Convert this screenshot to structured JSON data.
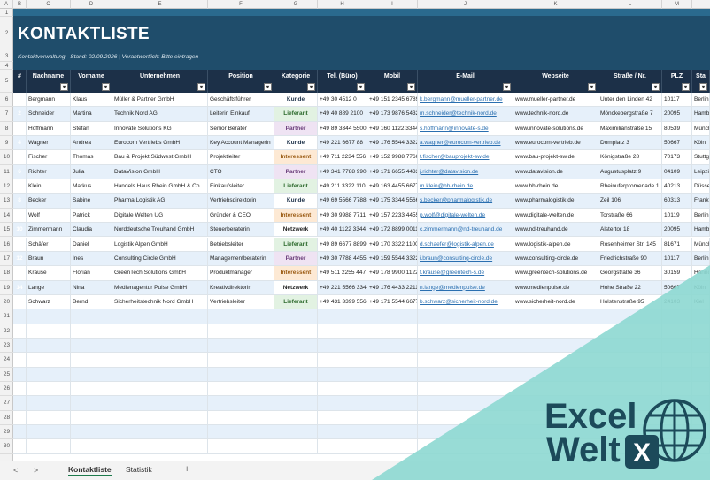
{
  "columns": [
    "A",
    "B",
    "C",
    "D",
    "E",
    "F",
    "G",
    "H",
    "I",
    "J",
    "K",
    "L",
    "M"
  ],
  "banner": {
    "title": "KONTAKTLISTE",
    "subtitle": "Kontaktverwaltung · Stand: 02.09.2026 | Verantwortlich: Bitte eintragen"
  },
  "headers": [
    "#",
    "Nachname",
    "Vorname",
    "Unternehmen",
    "Position",
    "Kategorie",
    "Tel. (Büro)",
    "Mobil",
    "E-Mail",
    "Webseite",
    "Straße / Nr.",
    "PLZ",
    "Sta"
  ],
  "filter_icon": "dropdown-arrow-icon",
  "rows": [
    [
      "1",
      "Bergmann",
      "Klaus",
      "Müller & Partner GmbH",
      "Geschäftsführer",
      "Kunde",
      "+49 30 4512 0",
      "+49 151 2345 6789",
      "k.bergmann@mueller-partner.de",
      "www.mueller-partner.de",
      "Unter den Linden 42",
      "10117",
      "Berlin"
    ],
    [
      "2",
      "Schneider",
      "Martina",
      "Technik Nord AG",
      "Leiterin Einkauf",
      "Lieferant",
      "+49 40 889 2100",
      "+49 173 9876 5432",
      "m.schneider@technik-nord.de",
      "www.technik-nord.de",
      "Mönckebergstraße 7",
      "20095",
      "Hamb"
    ],
    [
      "3",
      "Hoffmann",
      "Stefan",
      "Innovate Solutions KG",
      "Senior Berater",
      "Partner",
      "+49 89 3344 5500",
      "+49 160 1122 3344",
      "s.hoffmann@innovate-s.de",
      "www.innovate-solutions.de",
      "Maximilianstraße 15",
      "80539",
      "Münch"
    ],
    [
      "4",
      "Wagner",
      "Andrea",
      "Eurocom Vertriebs GmbH",
      "Key Account Managerin",
      "Kunde",
      "+49 221 6677 88",
      "+49 176 5544 3322",
      "a.wagner@eurocom-vertrieb.de",
      "www.eurocom-vertrieb.de",
      "Domplatz 3",
      "50667",
      "Köln"
    ],
    [
      "5",
      "Fischer",
      "Thomas",
      "Bau & Projekt Südwest GmbH",
      "Projektleiter",
      "Interessent",
      "+49 711 2234 556",
      "+49 152 9988 7766",
      "t.fischer@bauprojekt-sw.de",
      "www.bau-projekt-sw.de",
      "Königstraße 28",
      "70173",
      "Stuttg"
    ],
    [
      "6",
      "Richter",
      "Julia",
      "DataVision GmbH",
      "CTO",
      "Partner",
      "+49 341 7788 990",
      "+49 171 6655 4433",
      "j.richter@datavision.de",
      "www.datavision.de",
      "Augustusplatz 9",
      "04109",
      "Leipzi"
    ],
    [
      "7",
      "Klein",
      "Markus",
      "Handels Haus Rhein GmbH & Co.",
      "Einkaufsleiter",
      "Lieferant",
      "+49 211 3322 110",
      "+49 163 4455 6677",
      "m.klein@hh-rhein.de",
      "www.hh-rhein.de",
      "Rheinuferpromenade 1",
      "40213",
      "Düsse"
    ],
    [
      "8",
      "Becker",
      "Sabine",
      "Pharma Logistik AG",
      "Vertriebsdirektorin",
      "Kunde",
      "+49 69 5566 7788",
      "+49 175 3344 5566",
      "s.becker@pharmalogistik.de",
      "www.pharmalogistik.de",
      "Zeil 106",
      "60313",
      "Frankf"
    ],
    [
      "9",
      "Wolf",
      "Patrick",
      "Digitale Welten UG",
      "Gründer & CEO",
      "Interessent",
      "+49 30 9988 7711",
      "+49 157 2233 4455",
      "p.wolf@digitale-welten.de",
      "www.digitale-welten.de",
      "Torstraße 66",
      "10119",
      "Berlin"
    ],
    [
      "10",
      "Zimmermann",
      "Claudia",
      "Norddeutsche Treuhand GmbH",
      "Steuerberaterin",
      "Netzwerk",
      "+49 40 1122 3344",
      "+49 172 8899 0011",
      "c.zimmermann@nd-treuhand.de",
      "www.nd-treuhand.de",
      "Alstertor 18",
      "20095",
      "Hamb"
    ],
    [
      "11",
      "Schäfer",
      "Daniel",
      "Logistik Alpen GmbH",
      "Betriebsleiter",
      "Lieferant",
      "+49 89 6677 8899",
      "+49 170 3322 1100",
      "d.schaefer@logistik-alpen.de",
      "www.logistik-alpen.de",
      "Rosenheimer Str. 145",
      "81671",
      "Münch"
    ],
    [
      "12",
      "Braun",
      "Ines",
      "Consulting Circle GmbH",
      "Managementberaterin",
      "Partner",
      "+49 30 7788 4455",
      "+49 159 5544 3322",
      "i.braun@consulting-circle.de",
      "www.consulting-circle.de",
      "Friedrichstraße 90",
      "10117",
      "Berlin"
    ],
    [
      "13",
      "Krause",
      "Florian",
      "GreenTech Solutions GmbH",
      "Produktmanager",
      "Interessent",
      "+49 511 2255 4477",
      "+49 178 9900 1122",
      "f.krause@greentech-s.de",
      "www.greentech-solutions.de",
      "Georgstraße 36",
      "30159",
      "Hanno"
    ],
    [
      "14",
      "Lange",
      "Nina",
      "Medienagentur Pulse GmbH",
      "Kreativdirektorin",
      "Netzwerk",
      "+49 221 5566 3344",
      "+49 176 4433 2211",
      "n.lange@medienpulse.de",
      "www.medienpulse.de",
      "Hohe Straße 22",
      "50667",
      "Köln"
    ],
    [
      "15",
      "Schwarz",
      "Bernd",
      "Sicherheitstechnik Nord GmbH",
      "Vertriebsleiter",
      "Lieferant",
      "+49 431 3399 5566",
      "+49 171 5544 6677",
      "b.schwarz@sicherheit-nord.de",
      "www.sicherheit-nord.de",
      "Holstenstraße 95",
      "24103",
      "Kiel"
    ]
  ],
  "category_colors": {
    "Kunde": {
      "bg": "#ffffff",
      "fg": "#1c3048"
    },
    "Lieferant": {
      "bg": "#e2f2e2",
      "fg": "#2d6a2d"
    },
    "Partner": {
      "bg": "#efe3f3",
      "fg": "#6a3d7a"
    },
    "Interessent": {
      "bg": "#fde9d4",
      "fg": "#9a5a12"
    },
    "Netzwerk": {
      "bg": "#ffffff",
      "fg": "#222222"
    }
  },
  "row_numbers": [
    "1",
    "2",
    "3",
    "4",
    "5",
    "6",
    "7",
    "8",
    "9",
    "10",
    "11",
    "12",
    "13",
    "14",
    "15",
    "16",
    "17",
    "18",
    "19",
    "20",
    "21",
    "22",
    "23",
    "24",
    "25",
    "26",
    "27",
    "28",
    "29",
    "30"
  ],
  "tabs": {
    "prev_label": "<",
    "next_label": ">",
    "active": "Kontaktliste",
    "other": "Statistik",
    "add_label": "+"
  },
  "watermark": {
    "line1": "Excel",
    "line2": "Welt",
    "icon_letter": "X"
  },
  "colors": {
    "banner": "#1f4d6b",
    "header": "#1c3048",
    "band": "#e6f0fa",
    "watermark": "#8dd8d2",
    "logo": "#1c4a5a"
  }
}
